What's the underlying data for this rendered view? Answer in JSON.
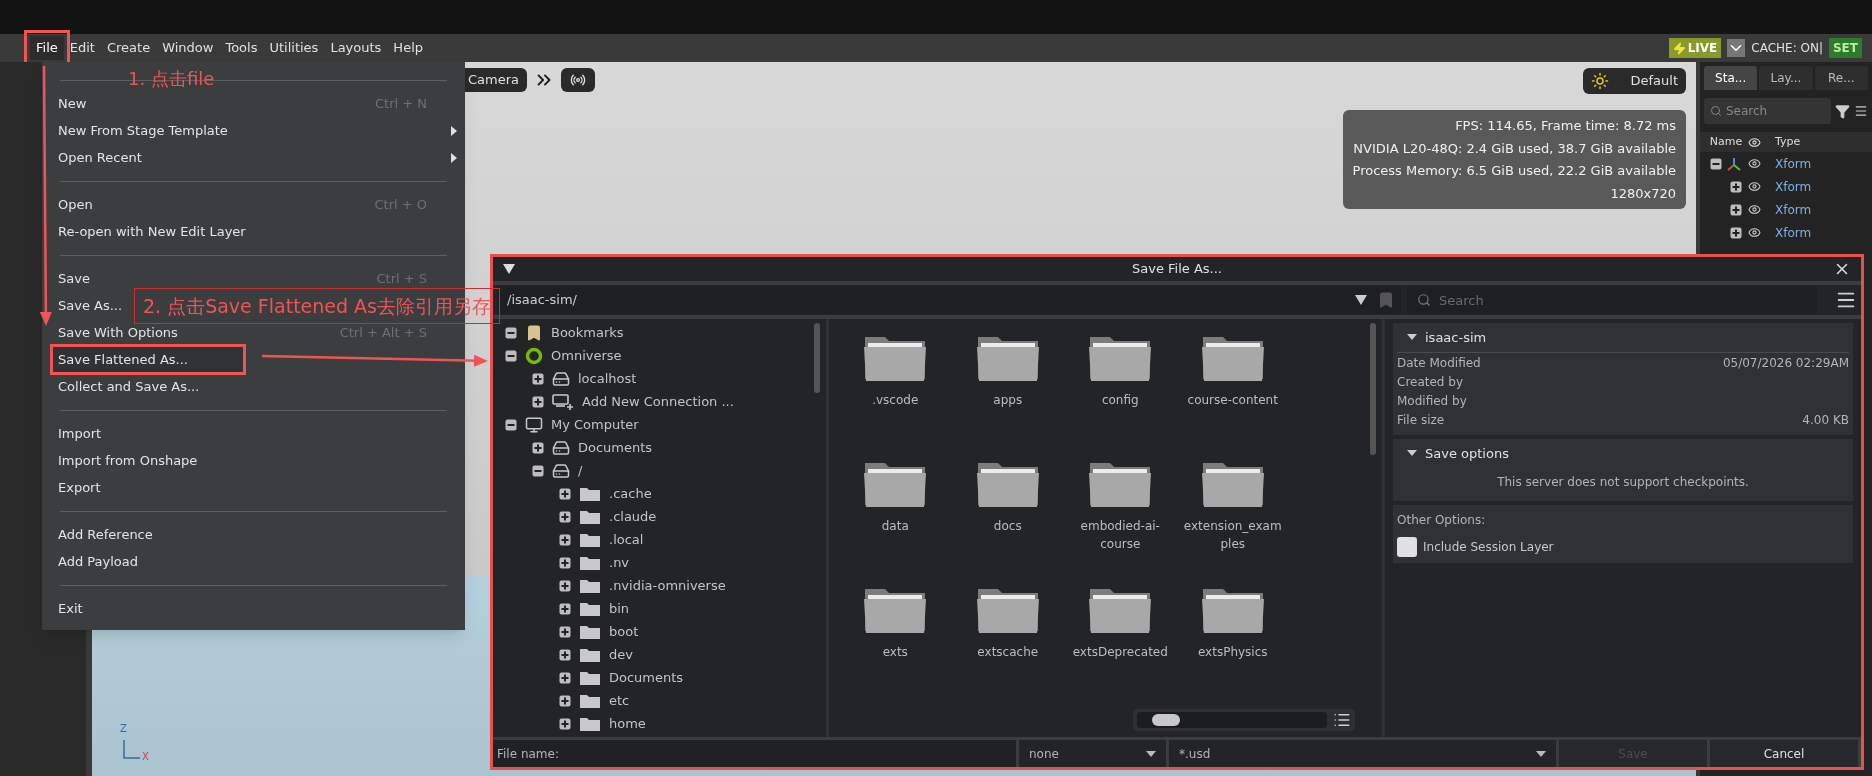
{
  "menubar": {
    "menus": [
      {
        "label": "File",
        "selected": true
      },
      {
        "label": "Edit",
        "selected": false
      },
      {
        "label": "Create",
        "selected": false
      },
      {
        "label": "Window",
        "selected": false
      },
      {
        "label": "Tools",
        "selected": false
      },
      {
        "label": "Utilities",
        "selected": false
      },
      {
        "label": "Layouts",
        "selected": false
      },
      {
        "label": "Help",
        "selected": false
      }
    ],
    "live": "LIVE",
    "cache": "CACHE: ON|",
    "set": "SET"
  },
  "viewport": {
    "camera_button": "Camera",
    "render_mode": "Default",
    "stats": [
      "FPS: 114.65, Frame time: 8.72 ms",
      "NVIDIA L20-48Q: 2.4 GiB used, 38.7 GiB available",
      "Process Memory: 6.5 GiB used, 22.2 GiB available",
      "1280x720"
    ],
    "axis_labels": [
      "Z",
      "X"
    ]
  },
  "stage_panel": {
    "tabs": [
      {
        "label": "Sta...",
        "selected": true
      },
      {
        "label": "Lay...",
        "selected": false
      },
      {
        "label": "Re...",
        "selected": false
      }
    ],
    "search": {
      "placeholder": "Search"
    },
    "columns": [
      "Name",
      "Type"
    ],
    "rows": [
      {
        "kind": "axis",
        "type": "Xform",
        "expanded": true
      },
      {
        "kind": "plain",
        "type": "Xform",
        "expanded": false
      },
      {
        "kind": "plain",
        "type": "Xform",
        "expanded": false
      },
      {
        "kind": "plain",
        "type": "Xform",
        "expanded": false
      }
    ]
  },
  "file_menu": {
    "items": [
      {
        "kind": "separator"
      },
      {
        "kind": "item",
        "label": "New",
        "shortcut": "Ctrl + N",
        "submenu": false,
        "selected": false
      },
      {
        "kind": "item",
        "label": "New From Stage Template",
        "submenu": true,
        "selected": false
      },
      {
        "kind": "item",
        "label": "Open Recent",
        "submenu": true,
        "selected": false
      },
      {
        "kind": "separator"
      },
      {
        "kind": "item",
        "label": "Open",
        "shortcut": "Ctrl + O",
        "submenu": false,
        "selected": false
      },
      {
        "kind": "item",
        "label": "Re-open with New Edit Layer",
        "submenu": false,
        "selected": false
      },
      {
        "kind": "separator"
      },
      {
        "kind": "item",
        "label": "Save",
        "shortcut": "Ctrl + S",
        "submenu": false,
        "selected": false
      },
      {
        "kind": "item",
        "label": "Save As...",
        "submenu": false,
        "selected": false
      },
      {
        "kind": "item",
        "label": "Save With Options",
        "shortcut": "Ctrl + Alt + S",
        "submenu": false,
        "selected": false
      },
      {
        "kind": "item",
        "label": "Save Flattened As...",
        "submenu": false,
        "selected": true
      },
      {
        "kind": "item",
        "label": "Collect and Save As...",
        "submenu": false,
        "selected": false
      },
      {
        "kind": "separator"
      },
      {
        "kind": "item",
        "label": "Import",
        "submenu": false,
        "selected": false
      },
      {
        "kind": "item",
        "label": "Import from Onshape",
        "submenu": false,
        "selected": false
      },
      {
        "kind": "item",
        "label": "Export",
        "submenu": false,
        "selected": false
      },
      {
        "kind": "separator"
      },
      {
        "kind": "item",
        "label": "Add Reference",
        "submenu": false,
        "selected": false
      },
      {
        "kind": "item",
        "label": "Add Payload",
        "submenu": false,
        "selected": false
      },
      {
        "kind": "separator"
      },
      {
        "kind": "item",
        "label": "Exit",
        "submenu": false,
        "selected": false
      }
    ]
  },
  "dialog": {
    "title": "Save File As...",
    "path": "/isaac-sim/",
    "search": {
      "placeholder": "Search"
    },
    "tree": [
      {
        "kind": "bookmark",
        "label": "Bookmarks",
        "expanded": true
      },
      {
        "kind": "omniverse",
        "label": "Omniverse",
        "expanded": true,
        "children": [
          {
            "kind": "drive",
            "label": "localhost",
            "expanded": false
          },
          {
            "kind": "add-connection",
            "label": "Add New Connection ...",
            "expanded": false
          }
        ]
      },
      {
        "kind": "computer",
        "label": "My Computer",
        "expanded": true,
        "children": [
          {
            "kind": "drive",
            "label": "Documents",
            "expanded": false
          },
          {
            "kind": "drive",
            "label": "/",
            "expanded": true,
            "children": [
              {
                "kind": "folder",
                "label": ".cache",
                "expanded": false
              },
              {
                "kind": "folder",
                "label": ".claude",
                "expanded": false
              },
              {
                "kind": "folder",
                "label": ".local",
                "expanded": false
              },
              {
                "kind": "folder",
                "label": ".nv",
                "expanded": false
              },
              {
                "kind": "folder",
                "label": ".nvidia-omniverse",
                "expanded": false
              },
              {
                "kind": "folder",
                "label": "bin",
                "expanded": false
              },
              {
                "kind": "folder",
                "label": "boot",
                "expanded": false
              },
              {
                "kind": "folder",
                "label": "dev",
                "expanded": false
              },
              {
                "kind": "folder",
                "label": "Documents",
                "expanded": false
              },
              {
                "kind": "folder",
                "label": "etc",
                "expanded": false
              },
              {
                "kind": "folder",
                "label": "home",
                "expanded": false
              }
            ]
          }
        ]
      }
    ],
    "folders": [
      ".vscode",
      "apps",
      "config",
      "course-content",
      "data",
      "docs",
      "embodied-ai-course",
      "extension_examples",
      "exts",
      "extscache",
      "extsDeprecated",
      "extsPhysics"
    ],
    "zoom": {
      "level": 0.15
    },
    "info": {
      "title": "isaac-sim",
      "expanded": true,
      "rows": [
        {
          "label": "Date Modified",
          "value": "05/07/2026 02:29AM"
        },
        {
          "label": "Created by"
        },
        {
          "label": "Modified by"
        },
        {
          "label": "File size",
          "value": "4.00 KB"
        }
      ]
    },
    "save_options": {
      "title": "Save options",
      "expanded": true,
      "message": "This server does not support checkpoints."
    },
    "other_options": {
      "title": "Other Options:",
      "checkboxes": [
        {
          "label": "Include Session Layer",
          "checked": false
        }
      ]
    },
    "filename_label": "File name:",
    "filter_1": "none",
    "filter_2": "*.usd",
    "buttons": [
      {
        "label": "Save",
        "disabled": true
      },
      {
        "label": "Cancel",
        "disabled": false
      }
    ]
  },
  "annotations": [
    {
      "kind": "plain",
      "text": "1. 点击file"
    },
    {
      "kind": "boxed",
      "text": "2. 点击Save Flattened As去除引用另存"
    }
  ]
}
